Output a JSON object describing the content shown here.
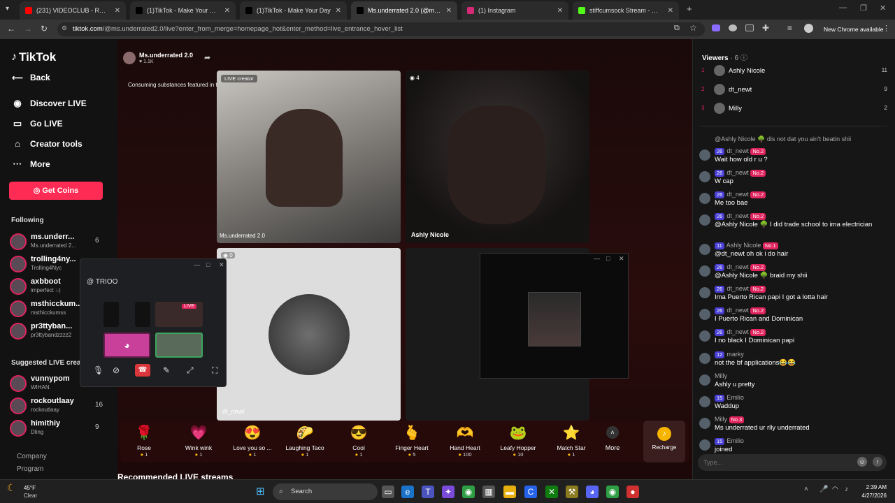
{
  "browser": {
    "tabs": [
      {
        "title": "(231) VIDEOCLUB - ROI Instrum",
        "color": "#ff0000",
        "icon": "youtube-icon"
      },
      {
        "title": "(1)TikTok - Make Your Day",
        "color": "#000000",
        "icon": "tiktok-icon"
      },
      {
        "title": "(1)TikTok - Make Your Day",
        "color": "#000000",
        "icon": "tiktok-icon"
      },
      {
        "title": "Ms.underrated 2.0 (@ms.un",
        "color": "#000000",
        "icon": "tiktok-icon",
        "active": true
      },
      {
        "title": "(1) Instagram",
        "color": "#d62976",
        "icon": "instagram-icon"
      },
      {
        "title": "stiffcumsock Stream - Watch Li",
        "color": "#53fc18",
        "icon": "kick-icon"
      }
    ],
    "url_domain": "tiktok.com",
    "url_rest": "/@ms.underrated2.0/live?enter_from_merge=homepage_hot&enter_method=live_entrance_hover_list",
    "chrome_notice": "New Chrome available"
  },
  "sidebar": {
    "logo": "TikTok",
    "back": "Back",
    "nav": [
      {
        "label": "Discover LIVE",
        "icon": "live-icon"
      },
      {
        "label": "Go LIVE",
        "icon": "camera-icon"
      },
      {
        "label": "Creator tools",
        "icon": "home-icon"
      },
      {
        "label": "More",
        "icon": "more-icon"
      }
    ],
    "get_coins": "Get Coins",
    "following_title": "Following",
    "following": [
      {
        "name": "ms.underr...",
        "sub": "Ms.underrated 2...",
        "count": "6"
      },
      {
        "name": "trolling4ny...",
        "sub": "Trolling4Nyc",
        "count": ""
      },
      {
        "name": "axbboot",
        "sub": "imperfect :-)",
        "count": ""
      },
      {
        "name": "msthicckum...",
        "sub": "msthicckumss",
        "count": ""
      },
      {
        "name": "pr3ttyban...",
        "sub": "pr3ttybandzzzz2",
        "count": ""
      }
    ],
    "suggested_title": "Suggested LIVE creators",
    "suggested": [
      {
        "name": "vunnypom",
        "sub": "WIHAN.",
        "count": ""
      },
      {
        "name": "rockoutlaay",
        "sub": "rockoutlaay",
        "count": "16"
      },
      {
        "name": "himithiy",
        "sub": "Dling",
        "count": "9"
      }
    ],
    "footer": [
      "Company",
      "Program"
    ]
  },
  "stage": {
    "host_name": "Ms.underrated 2.0",
    "host_likes": "1.1K",
    "warning": "Consuming substances featured in this LIVE could ha...",
    "tiles": [
      {
        "badge": "LIVE creator",
        "label": "Ms.underrated 2.0"
      },
      {
        "badge": "4",
        "label": "Ashly Nicole"
      },
      {
        "badge": "0",
        "label": "dt_newt"
      }
    ],
    "recommended": "Recommended LIVE streams"
  },
  "gifts": [
    {
      "name": "Rose",
      "price": "1",
      "icon": "🌹"
    },
    {
      "name": "Wink wink",
      "price": "1",
      "icon": "💗"
    },
    {
      "name": "Love you so ...",
      "price": "1",
      "icon": "😍"
    },
    {
      "name": "Laughing Taco",
      "price": "1",
      "icon": "🌮"
    },
    {
      "name": "Cool",
      "price": "1",
      "icon": "😎"
    },
    {
      "name": "Finger Heart",
      "price": "5",
      "icon": "🫰"
    },
    {
      "name": "Hand Heart",
      "price": "100",
      "icon": "🫶"
    },
    {
      "name": "Leafy Hopper",
      "price": "10",
      "icon": "🐸"
    },
    {
      "name": "Match Star",
      "price": "1",
      "icon": "⭐"
    }
  ],
  "gifts_more": "More",
  "recharge": "Recharge",
  "discord_popup": {
    "title": "TRIOO",
    "live_tag": "LIVE"
  },
  "viewers": {
    "title": "Viewers",
    "count": "6",
    "list": [
      {
        "rank": "1",
        "name": "Ashly Nicole",
        "score": "11"
      },
      {
        "rank": "2",
        "name": "dt_newt",
        "score": "9"
      },
      {
        "rank": "3",
        "name": "Milly",
        "score": "2"
      }
    ]
  },
  "chat": [
    {
      "user": "",
      "text": "@Ashly Nicole 🌳 dis not dat you ain't beatin shii",
      "badge": "",
      "rankbadge": ""
    },
    {
      "user": "dt_newt",
      "text": "Wait how old r u ?",
      "badge": "26",
      "rankbadge": "No.2"
    },
    {
      "user": "dt_newt",
      "text": "W cap",
      "badge": "26",
      "rankbadge": "No.2"
    },
    {
      "user": "dt_newt",
      "text": "Me too bae",
      "badge": "26",
      "rankbadge": "No.2"
    },
    {
      "user": "dt_newt",
      "text": "@Ashly Nicole 🌳 I did trade school to ima electrician",
      "badge": "26",
      "rankbadge": "No.2"
    },
    {
      "user": "Ashly Nicole",
      "text": "@dt_newt oh ok i do hair",
      "badge": "11",
      "rankbadge": "No.1"
    },
    {
      "user": "dt_newt",
      "text": "@Ashly Nicole 🌳 braid my shii",
      "badge": "26",
      "rankbadge": "No.2"
    },
    {
      "user": "dt_newt",
      "text": "Ima Puerto Rican papi I got a lotta hair",
      "badge": "26",
      "rankbadge": "No.2"
    },
    {
      "user": "dt_newt",
      "text": "I Puerto Rican and Dominican",
      "badge": "26",
      "rankbadge": "No.2"
    },
    {
      "user": "dt_newt",
      "text": "I no black I Dominican papi",
      "badge": "26",
      "rankbadge": "No.2"
    },
    {
      "user": "marky",
      "text": "not the bf applications😂😂",
      "badge": "12",
      "rankbadge": ""
    },
    {
      "user": "Milly",
      "text": "Ashly u pretty",
      "badge": "",
      "rankbadge": ""
    },
    {
      "user": "Emilio",
      "text": "Waddup",
      "badge": "15",
      "rankbadge": ""
    },
    {
      "user": "Milly",
      "text": "Ms underrated ur rlly underrated",
      "badge": "",
      "rankbadge": "No.3"
    },
    {
      "user": "Emilio",
      "text": "joined",
      "badge": "15",
      "rankbadge": ""
    }
  ],
  "chat_input_placeholder": "Type...",
  "taskbar": {
    "weather_temp": "45°F",
    "weather_text": "Clear",
    "search": "Search",
    "time": "2:39 AM",
    "date": "4/27/2026"
  }
}
